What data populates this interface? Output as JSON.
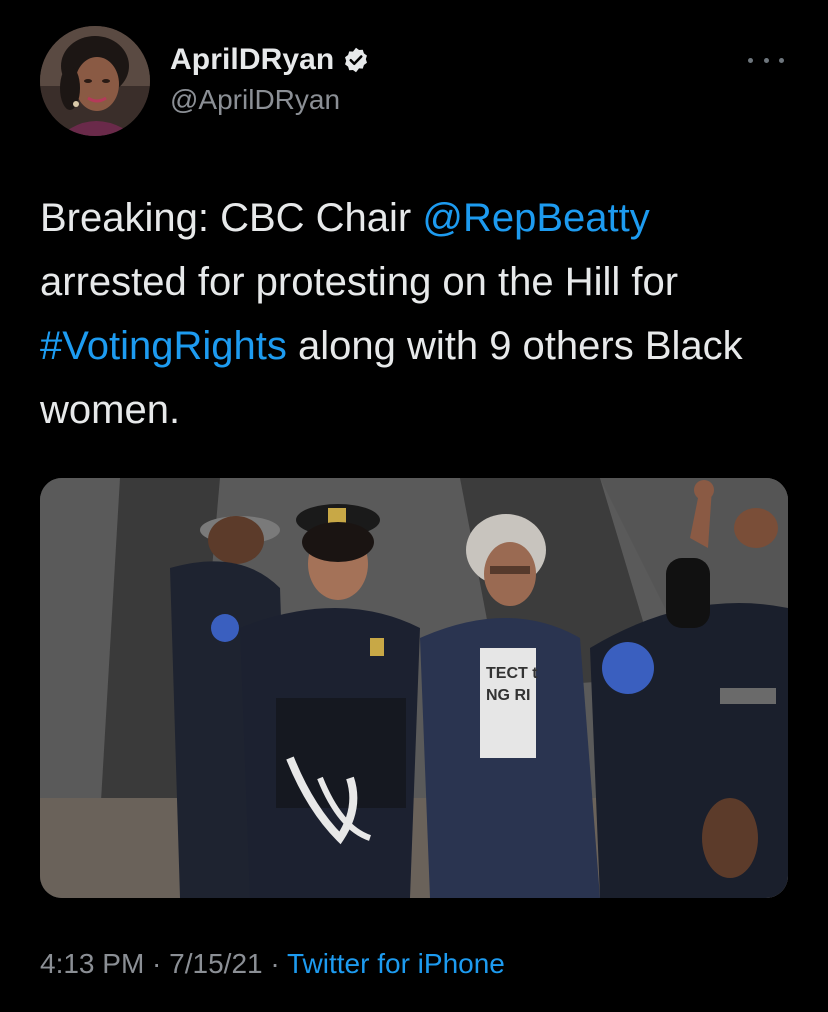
{
  "tweet": {
    "display_name": "AprilDRyan",
    "handle": "@AprilDRyan",
    "verified": true,
    "more_icon": "more-horizontal-icon",
    "text": {
      "part1": "Breaking: CBC Chair ",
      "mention": "@RepBeatty",
      "part2": " arrested for protesting on the Hill for ",
      "hashtag": "#VotingRights",
      "part3": " along with 9 others Black women."
    },
    "time": "4:13 PM",
    "separator": " · ",
    "date": "7/15/21",
    "source": "Twitter for iPhone",
    "media_text": {
      "shirt_line1": "TECT t",
      "shirt_line2": "NG RI"
    }
  },
  "colors": {
    "background": "#000000",
    "text": "#e7e9ea",
    "secondary": "#8b8f95",
    "link": "#1d9bf0",
    "verified_badge": "#e7e9ea"
  }
}
